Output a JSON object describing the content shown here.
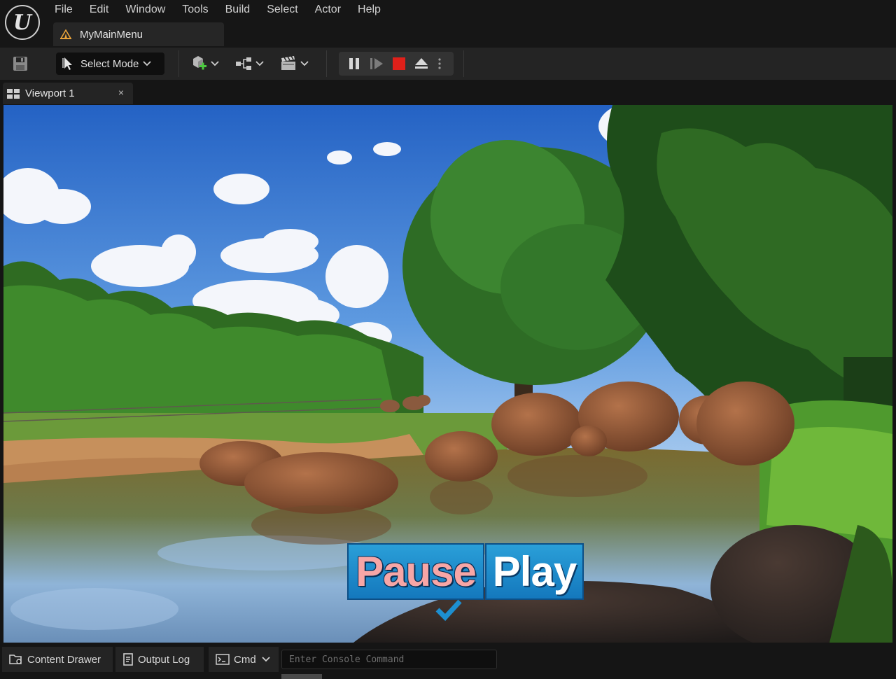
{
  "app": {
    "logo_letter": "U"
  },
  "menu": {
    "items": [
      "File",
      "Edit",
      "Window",
      "Tools",
      "Build",
      "Select",
      "Actor",
      "Help"
    ]
  },
  "document_tab": {
    "label": "MyMainMenu"
  },
  "toolbar": {
    "mode_label": "Select Mode"
  },
  "viewport": {
    "tab_label": "Viewport 1",
    "close_glyph": "×"
  },
  "hud": {
    "pause_label": "Pause",
    "play_label": "Play"
  },
  "statusbar": {
    "content_drawer": "Content Drawer",
    "output_log": "Output Log",
    "cmd_label": "Cmd",
    "console_placeholder": "Enter Console Command"
  },
  "colors": {
    "accent_stop": "#e0201a",
    "hud_button": "#1f8ccc",
    "hud_pause_text": "#f7a6a6",
    "check": "#1d8fd0"
  }
}
